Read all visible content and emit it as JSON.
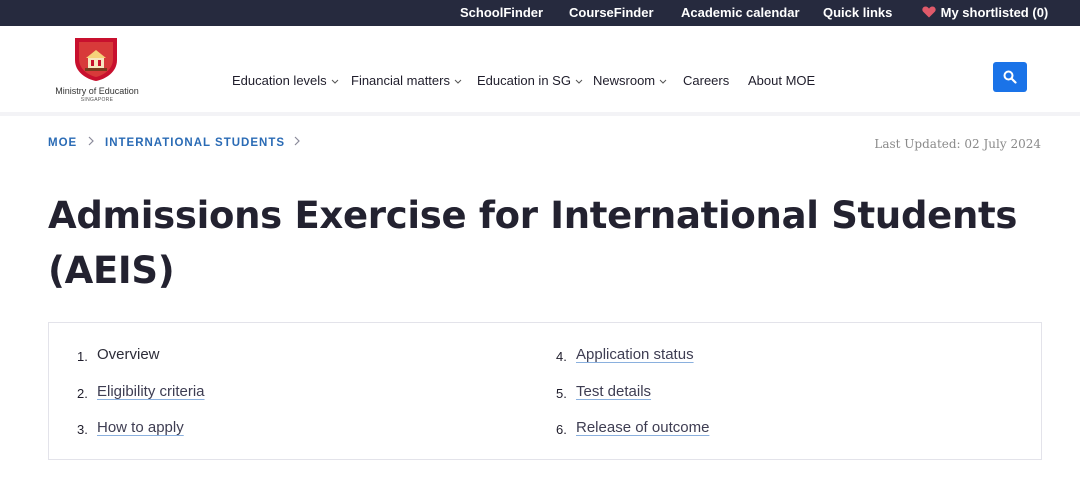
{
  "utility_bar": {
    "links": [
      "SchoolFinder",
      "CourseFinder",
      "Academic calendar",
      "Quick links",
      "My shortlisted (0)"
    ]
  },
  "logo": {
    "name": "Ministry of Education",
    "subtitle": "SINGAPORE"
  },
  "nav": {
    "items": [
      "Education levels",
      "Financial matters",
      "Education in SG",
      "Newsroom",
      "Careers",
      "About MOE"
    ]
  },
  "breadcrumb": {
    "items": [
      "MOE",
      "INTERNATIONAL STUDENTS"
    ]
  },
  "last_updated": "Last Updated: 02 July 2024",
  "page_title": "Admissions Exercise for International Students (AEIS)",
  "contents": {
    "items": [
      {
        "number": "1.",
        "label": "Overview"
      },
      {
        "number": "2.",
        "label": "Eligibility criteria"
      },
      {
        "number": "3.",
        "label": "How to apply"
      },
      {
        "number": "4.",
        "label": "Application status"
      },
      {
        "number": "5.",
        "label": "Test details"
      },
      {
        "number": "6.",
        "label": "Release of outcome"
      }
    ]
  },
  "colors": {
    "topbar": "#262a3e",
    "accent_blue": "#1a73e8",
    "breadcrumb_blue": "#2a6bb5",
    "heart": "#e05a6a",
    "logo_red": "#c8102e"
  }
}
